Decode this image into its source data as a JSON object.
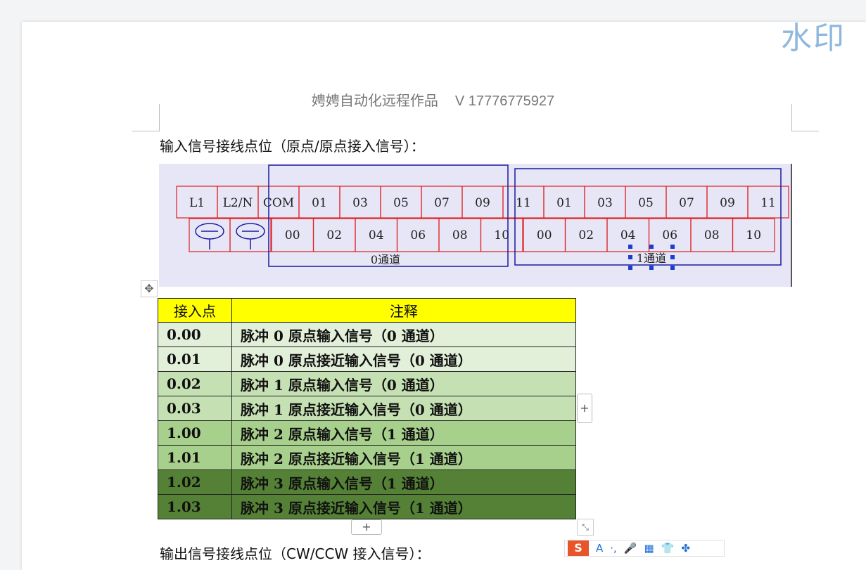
{
  "watermark": "水印",
  "header": {
    "left": "娉娉自动化远程作品",
    "right": "V 17776775927"
  },
  "sections": {
    "input_title": "输入信号接线点位（原点/原点接入信号）：",
    "output_title": "输出信号接线点位（CW/CCW 接入信号）："
  },
  "diagram": {
    "top_row": [
      "L1",
      "L2/N",
      "COM",
      "01",
      "03",
      "05",
      "07",
      "09",
      "11",
      "01",
      "03",
      "05",
      "07",
      "09",
      "11"
    ],
    "bottom_row_ch0": [
      "00",
      "02",
      "04",
      "06",
      "08",
      "10"
    ],
    "bottom_row_ch1": [
      "00",
      "02",
      "04",
      "06",
      "08",
      "10"
    ],
    "channel0_label": "0通道",
    "channel1_label": "1通道",
    "colors": {
      "terminal_border": "#e02020",
      "channel_box": "#1a1aa0",
      "background": "#e6e6f7"
    }
  },
  "table": {
    "headers": [
      "接入点",
      "注释"
    ],
    "rows": [
      {
        "point": "0.00",
        "note": "脉冲 0 原点输入信号（0 通道）"
      },
      {
        "point": "0.01",
        "note": "脉冲 0 原点接近输入信号（0 通道）"
      },
      {
        "point": "0.02",
        "note": "脉冲 1 原点输入信号（0 通道）"
      },
      {
        "point": "0.03",
        "note": "脉冲 1 原点接近输入信号（0 通道）"
      },
      {
        "point": "1.00",
        "note": "脉冲 2 原点输入信号（1 通道）"
      },
      {
        "point": "1.01",
        "note": "脉冲 2 原点接近输入信号（1 通道）"
      },
      {
        "point": "1.02",
        "note": "脉冲 3 原点输入信号（1 通道）"
      },
      {
        "point": "1.03",
        "note": "脉冲 3 原点接近输入信号（1 通道）"
      }
    ],
    "colors": {
      "header": "#ffff00",
      "band1": "#e2efd9",
      "band2": "#c5e0b3",
      "band3": "#a8d08d",
      "band4": "#548135"
    }
  },
  "controls": {
    "add_column": "+",
    "add_row": "+"
  },
  "ime_toolbar": {
    "logo": "S",
    "items": [
      "A",
      "·,",
      "mic-icon",
      "keyboard-icon",
      "shirt-icon",
      "grid-icon"
    ]
  }
}
